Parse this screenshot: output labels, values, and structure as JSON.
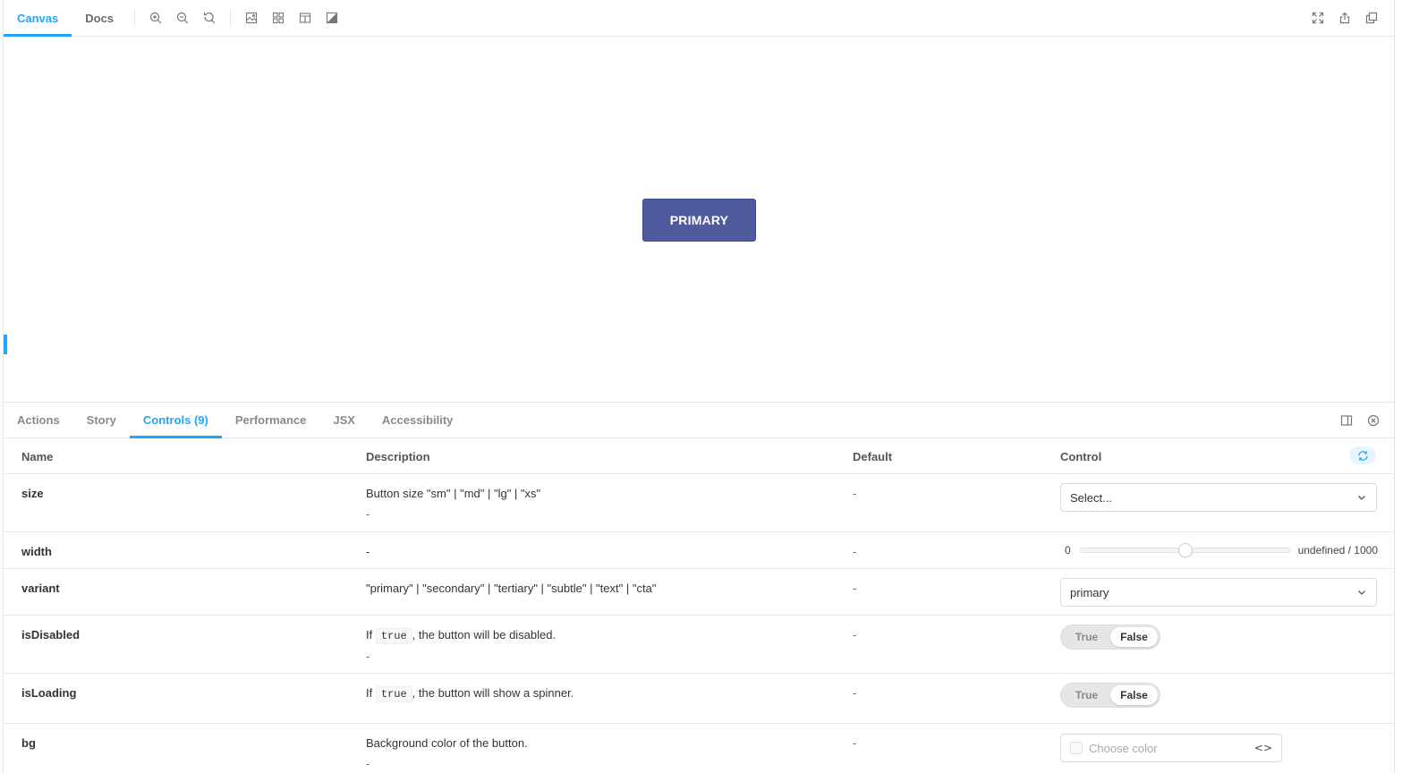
{
  "toolbar": {
    "tabs": [
      {
        "label": "Canvas",
        "active": true
      },
      {
        "label": "Docs",
        "active": false
      }
    ],
    "tools": [
      "zoom-in-icon",
      "zoom-out-icon",
      "zoom-reset-icon",
      "background-icon",
      "grid-icon",
      "viewport-icon",
      "theme-icon"
    ],
    "right_tools": [
      "fullscreen-icon",
      "share-icon",
      "copy-icon"
    ]
  },
  "canvas": {
    "button_label": "PRIMARY",
    "button_color": "#4f5b9c"
  },
  "panel": {
    "tabs": [
      {
        "label": "Actions",
        "active": false
      },
      {
        "label": "Story",
        "active": false
      },
      {
        "label": "Controls (9)",
        "active": true
      },
      {
        "label": "Performance",
        "active": false
      },
      {
        "label": "JSX",
        "active": false
      },
      {
        "label": "Accessibility",
        "active": false
      }
    ],
    "table": {
      "headers": {
        "name": "Name",
        "description": "Description",
        "default": "Default",
        "control": "Control"
      },
      "rows": {
        "size": {
          "name": "size",
          "description": "Button size \"sm\" | \"md\" | \"lg\" | \"xs\"",
          "sub": "-",
          "default": "-",
          "select_value": "Select..."
        },
        "width": {
          "name": "width",
          "description": "-",
          "default": "-",
          "range_min": "0",
          "range_value_label": "undefined / 1000",
          "range_fraction": 0.5
        },
        "variant": {
          "name": "variant",
          "description": "\"primary\" | \"secondary\" | \"tertiary\" | \"subtle\" | \"text\" | \"cta\"",
          "default": "-",
          "select_value": "primary"
        },
        "isDisabled": {
          "name": "isDisabled",
          "desc_before": "If",
          "desc_code": "true",
          "desc_after": ", the button will be disabled.",
          "sub": "-",
          "default": "-",
          "true_label": "True",
          "false_label": "False"
        },
        "isLoading": {
          "name": "isLoading",
          "desc_before": "If",
          "desc_code": "true",
          "desc_after": ", the button will show a spinner.",
          "default": "-",
          "true_label": "True",
          "false_label": "False"
        },
        "bg": {
          "name": "bg",
          "description": "Background color of the button.",
          "sub": "-",
          "default": "-",
          "color_placeholder": "Choose color"
        }
      }
    }
  },
  "colors": {
    "accent": "#1ea7fd"
  }
}
